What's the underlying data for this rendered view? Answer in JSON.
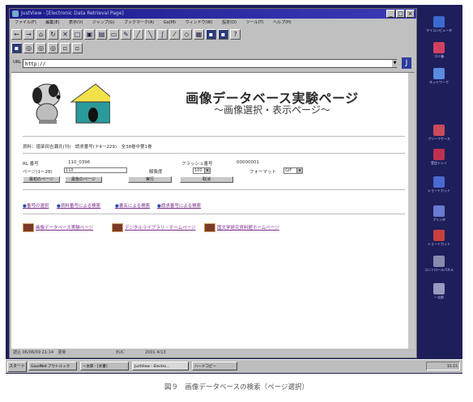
{
  "window": {
    "title": "JustView - [Electronic Data Retrieval Page]",
    "controls": [
      "_",
      "□",
      "×"
    ]
  },
  "menubar": [
    "ファイル(F)",
    "編集(E)",
    "表示(V)",
    "ジャンプ(G)",
    "ブックマーク(A)",
    "Go(M)",
    "ウィンドウ(W)",
    "設定(O)",
    "ツール(T)",
    "ヘルプ(H)"
  ],
  "address": {
    "label": "URL",
    "value": "http://"
  },
  "page": {
    "title": "画像データベース実験ページ",
    "subtitle": "～画像選択・表示ページ～",
    "source_line": "資料：徳架田吉瀬氏(刊)　請求番号(ナ4－229)　全38巻中第1巻",
    "rl_label": "RL 番号",
    "rl_value": "110_0396",
    "flash_label": "フラッシュ番号",
    "flash_value": "00000001",
    "page_label": "ページ(1～28)",
    "page_value": "110",
    "resolution_label": "解像度",
    "resolution_value": "100",
    "format_label": "フォーマット",
    "format_value": "GIF",
    "btn_first": "最初のページ",
    "btn_last": "最後のページ",
    "btn_run": "実行",
    "btn_cancel": "取消",
    "nav_links": [
      "番号の選択",
      "資料番号による検索",
      "書名による検索",
      "請求番号による検索"
    ],
    "footer_links": [
      "画像データベース実験ページ",
      "デジタルライブラリ・ホームページ",
      "国文学研究資料館ホームページ"
    ]
  },
  "status_bar": {
    "left": "読込 06/06/09 21:14",
    "mid1": "更新",
    "mid2": "EUC",
    "date": "2001 4/13"
  },
  "taskbar": {
    "start": "スタート",
    "items": [
      "GoodNet アウトルック",
      "一太郎 - [文書]",
      "JustView - Electro...",
      "ハードコピー"
    ],
    "clock": "15:15"
  },
  "desktop_icons": [
    "マイコンピュータ",
    "ゴミ箱",
    "ネットワーク",
    "ブリーフケース",
    "受信トレイ",
    "ショートカット",
    "プリンタ",
    "ショートカット",
    "コントロールパネル",
    "一太郎"
  ],
  "caption": "図９　画像データベースの検索（ページ選択）",
  "colors": {
    "titlebar": "#1c1c8c",
    "link": "#7a2a8a",
    "desktop": "#1e1e5a"
  }
}
